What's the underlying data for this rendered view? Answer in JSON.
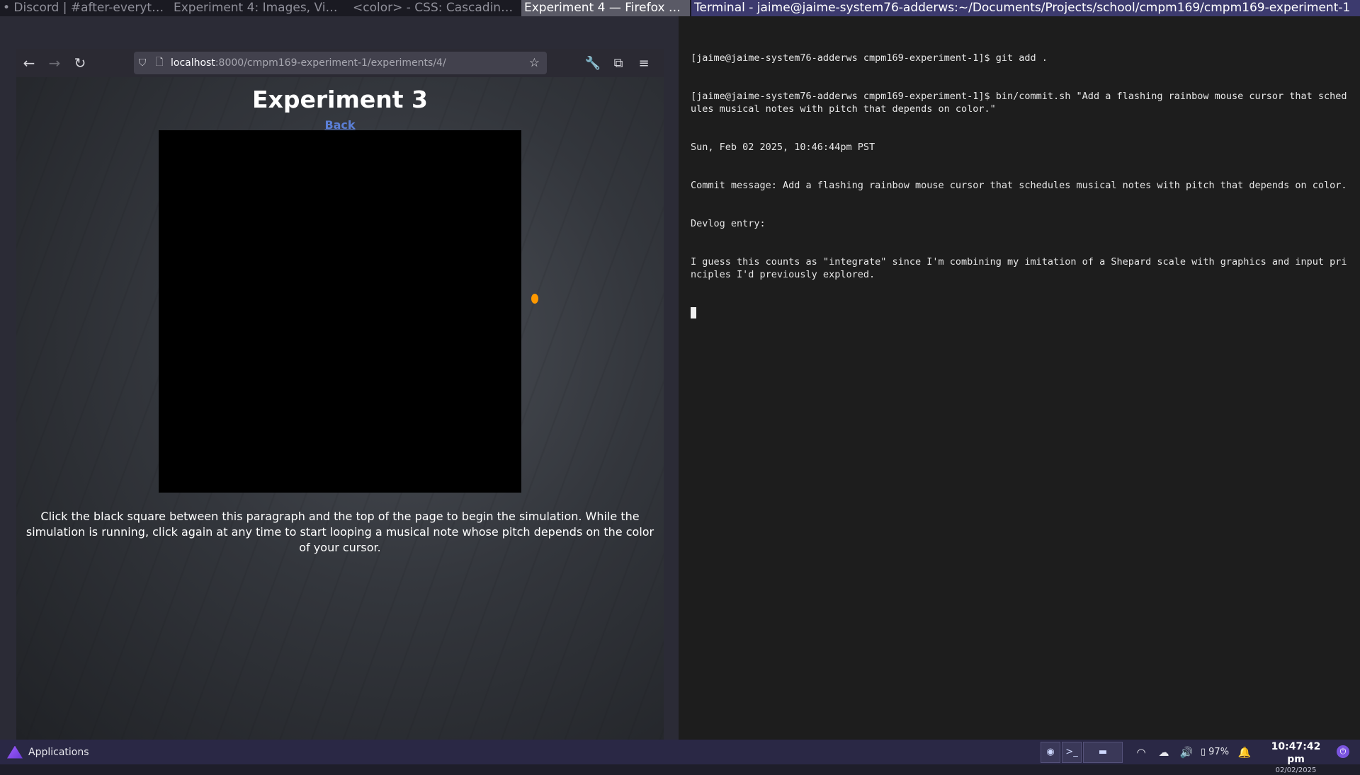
{
  "titlebar": {
    "windows": [
      "• Discord | #after-everythin...",
      "Experiment 4: Images, Vid...",
      "<color> - CSS: Cascading S...",
      "Experiment 4 — Firefox De...",
      "Terminal - jaime@jaime-system76-adderws:~/Documents/Projects/school/cmpm169/cmpm169-experiment-1"
    ]
  },
  "browser": {
    "url_host": "localhost",
    "url_path": ":8000/cmpm169-experiment-1/experiments/4/",
    "icons": {
      "back": "←",
      "forward": "→",
      "reload": "↻",
      "shield": "⛉",
      "page": "🗋",
      "star": "☆",
      "wrench": "🔧",
      "extensions": "⧉",
      "menu": "≡"
    },
    "page": {
      "title": "Experiment 3",
      "back_link": "Back",
      "instructions": "Click the black square between this paragraph and the top of the page to begin the simulation. While the simulation is running, click again at any time to start looping a musical note whose pitch depends on the color of your cursor.",
      "cursor_color": "#ff9900"
    }
  },
  "terminal": {
    "lines": [
      "[jaime@jaime-system76-adderws cmpm169-experiment-1]$ git add .",
      "[jaime@jaime-system76-adderws cmpm169-experiment-1]$ bin/commit.sh \"Add a flashing rainbow mouse cursor that schedules musical notes with pitch that depends on color.\"",
      "Sun, Feb 02 2025, 10:46:44pm PST",
      "Commit message: Add a flashing rainbow mouse cursor that schedules musical notes with pitch that depends on color.",
      "Devlog entry:",
      "I guess this counts as \"integrate\" since I'm combining my imitation of a Shepard scale with graphics and input principles I'd previously explored."
    ]
  },
  "panel": {
    "applications_label": "Applications",
    "task_icons": {
      "firefox": "◉",
      "terminal": ">_",
      "files": "▬"
    },
    "tray_icons": {
      "wifi": "◠",
      "network": "☁",
      "volume": "🔊",
      "notifications": "🔔",
      "power": "⏻"
    },
    "battery": "97%",
    "time": "10:47:42 pm",
    "date": "02/02/2025"
  }
}
